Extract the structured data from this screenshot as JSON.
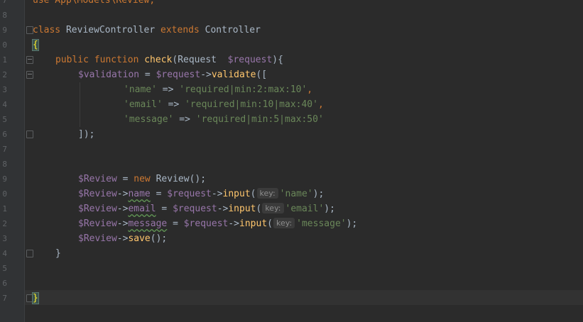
{
  "gutter": {
    "line_numbers": [
      "7",
      "8",
      "9",
      "0",
      "1",
      "2",
      "3",
      "4",
      "5",
      "6",
      "7",
      "8",
      "9",
      "0",
      "1",
      "2",
      "3",
      "4",
      "5",
      "6",
      "7"
    ]
  },
  "code": {
    "l0_a": "use App\\Models\\Review;",
    "l2_kw1": "class ",
    "l2_cls": "ReviewController ",
    "l2_kw2": "extends ",
    "l2_cls2": "Controller",
    "l3_brace": "{",
    "l4_kw1": "public function ",
    "l4_fn": "check",
    "l4_p1": "(Request  ",
    "l4_var": "$request",
    "l4_p2": "){",
    "l5_var1": "$validation",
    "l5_op": " = ",
    "l5_var2": "$request",
    "l5_arrow": "->",
    "l5_fn": "validate",
    "l5_p": "([",
    "l6_str1": "'name'",
    "l6_op": " => ",
    "l6_str2": "'required|min:2:max:10'",
    "l6_c": ",",
    "l7_str1": "'email'",
    "l7_op": " => ",
    "l7_str2": "'required|min:10|max:40'",
    "l7_c": ",",
    "l8_str1": "'message'",
    "l8_op": " => ",
    "l8_str2": "'required|min:5|max:50'",
    "l9_p": "]);",
    "l12_var": "$Review",
    "l12_op": " = ",
    "l12_kw": "new ",
    "l12_cls": "Review",
    "l12_p": "();",
    "l13_var": "$Review",
    "l13_arrow": "->",
    "l13_prop": "name",
    "l13_op": " = ",
    "l13_var2": "$request",
    "l13_arrow2": "->",
    "l13_fn": "input",
    "l13_p1": "(",
    "l13_hint": "key:",
    "l13_str": "'name'",
    "l13_p2": ");",
    "l14_var": "$Review",
    "l14_arrow": "->",
    "l14_prop": "email",
    "l14_op": " = ",
    "l14_var2": "$request",
    "l14_arrow2": "->",
    "l14_fn": "input",
    "l14_p1": "(",
    "l14_hint": "key:",
    "l14_str": "'email'",
    "l14_p2": ");",
    "l15_var": "$Review",
    "l15_arrow": "->",
    "l15_prop": "message",
    "l15_op": " = ",
    "l15_var2": "$request",
    "l15_arrow2": "->",
    "l15_fn": "input",
    "l15_p1": "(",
    "l15_hint": "key:",
    "l15_str": "'message'",
    "l15_p2": ");",
    "l16_var": "$Review",
    "l16_arrow": "->",
    "l16_fn": "save",
    "l16_p": "();",
    "l17_brace": "}",
    "l20_brace": "}"
  },
  "colors": {
    "background": "#2b2b2b",
    "keyword": "#cc7832",
    "function": "#ffc66d",
    "variable": "#9876aa",
    "string": "#6a8759",
    "default": "#a9b7c6"
  }
}
